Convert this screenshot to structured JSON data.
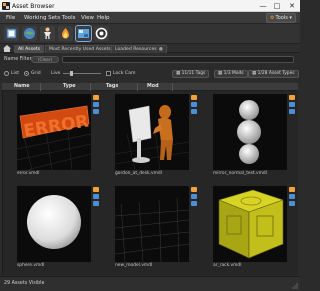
{
  "window": {
    "title": "Asset Browser"
  },
  "menubar": {
    "items": [
      "File",
      "Working Sets",
      "Tools",
      "View",
      "Help"
    ],
    "tools_button": "Tools"
  },
  "tabs": [
    {
      "label": "All Assets",
      "active": true
    },
    {
      "label": "Most Recently Used Assets",
      "active": false
    },
    {
      "label": "Loaded Resources",
      "active": false
    }
  ],
  "filter": {
    "label": "Name Filter:",
    "clear_label": "Clear",
    "value": ""
  },
  "view": {
    "list_label": "List",
    "grid_label": "Grid",
    "mode": "Grid",
    "live_label": "Live",
    "lock_cam_label": "Lock Cam",
    "tags_button": "11/11 Tags",
    "mods_button": "1/3 Mods",
    "types_button": "1/28 Asset Types"
  },
  "columns": [
    "Name",
    "Type",
    "Tags",
    "Mod"
  ],
  "assets": [
    {
      "name": "error.vmdl"
    },
    {
      "name": "gordon_at_desk.vmdl"
    },
    {
      "name": "mirror_normal_test.vmdl"
    },
    {
      "name": "sphere.vmdl"
    },
    {
      "name": "new_model.vmdl"
    },
    {
      "name": "ar_rack.vmdl"
    }
  ],
  "status": {
    "text": "29 Assets Visible"
  },
  "colors": {
    "accent_orange": "#f2a23a",
    "highlight_blue": "#7aa6d8",
    "badge_blue": "#4d8fd6"
  }
}
